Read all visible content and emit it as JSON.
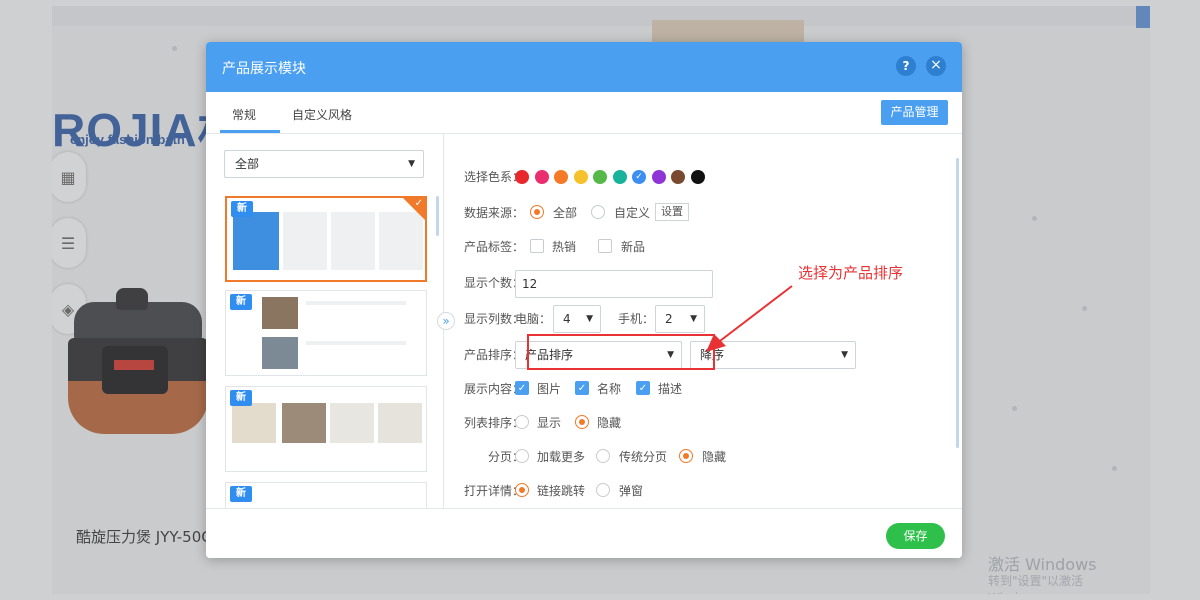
{
  "background": {
    "brand": "ROJIA机",
    "slogan": "enjoy fashion bath",
    "product_caption": "酷旋压力煲 JYY-50C",
    "win_line1": "激活 Windows",
    "win_line2": "转到\"设置\"以激活 Windows。"
  },
  "modal": {
    "title": "产品展示模块",
    "help_icon": "?",
    "close_icon": "×",
    "tabs": [
      {
        "label": "常规"
      },
      {
        "label": "自定义风格"
      }
    ],
    "manage_button": "产品管理",
    "category_select": "全部",
    "badge_new": "新",
    "collapse_icon": "»",
    "save_button": "保存"
  },
  "form": {
    "color_scheme": {
      "label": "选择色系：",
      "colors": [
        "#e8282b",
        "#ea2e6e",
        "#f47a27",
        "#f5c22b",
        "#55b848",
        "#19b39b",
        "#3d8ef3",
        "#8f35d8",
        "#7a4a30",
        "#111111"
      ],
      "selected_index": 6
    },
    "data_source": {
      "label": "数据来源：",
      "options": [
        "全部",
        "自定义"
      ],
      "selected": "全部",
      "settings_button": "设置"
    },
    "product_tags": {
      "label": "产品标签：",
      "options": [
        "热销",
        "新品"
      ]
    },
    "display_count": {
      "label": "显示个数：",
      "value": "12"
    },
    "display_columns": {
      "label": "显示列数：",
      "pc_label": "电脑：",
      "pc_value": "4",
      "mobile_label": "手机：",
      "mobile_value": "2"
    },
    "sort": {
      "label": "产品排序：",
      "field": "产品排序",
      "order": "降序"
    },
    "display_content": {
      "label": "展示内容：",
      "options": [
        "图片",
        "名称",
        "描述"
      ]
    },
    "list_sort": {
      "label": "列表排序：",
      "options": [
        "显示",
        "隐藏"
      ],
      "selected": "隐藏"
    },
    "pagination": {
      "label": "分页：",
      "options": [
        "加载更多",
        "传统分页",
        "隐藏"
      ],
      "selected": "隐藏"
    },
    "open_detail": {
      "label": "打开详情：",
      "options": [
        "链接跳转",
        "弹窗"
      ],
      "selected": "链接跳转"
    }
  },
  "annotation": {
    "text": "选择为产品排序",
    "color": "#e83234"
  }
}
